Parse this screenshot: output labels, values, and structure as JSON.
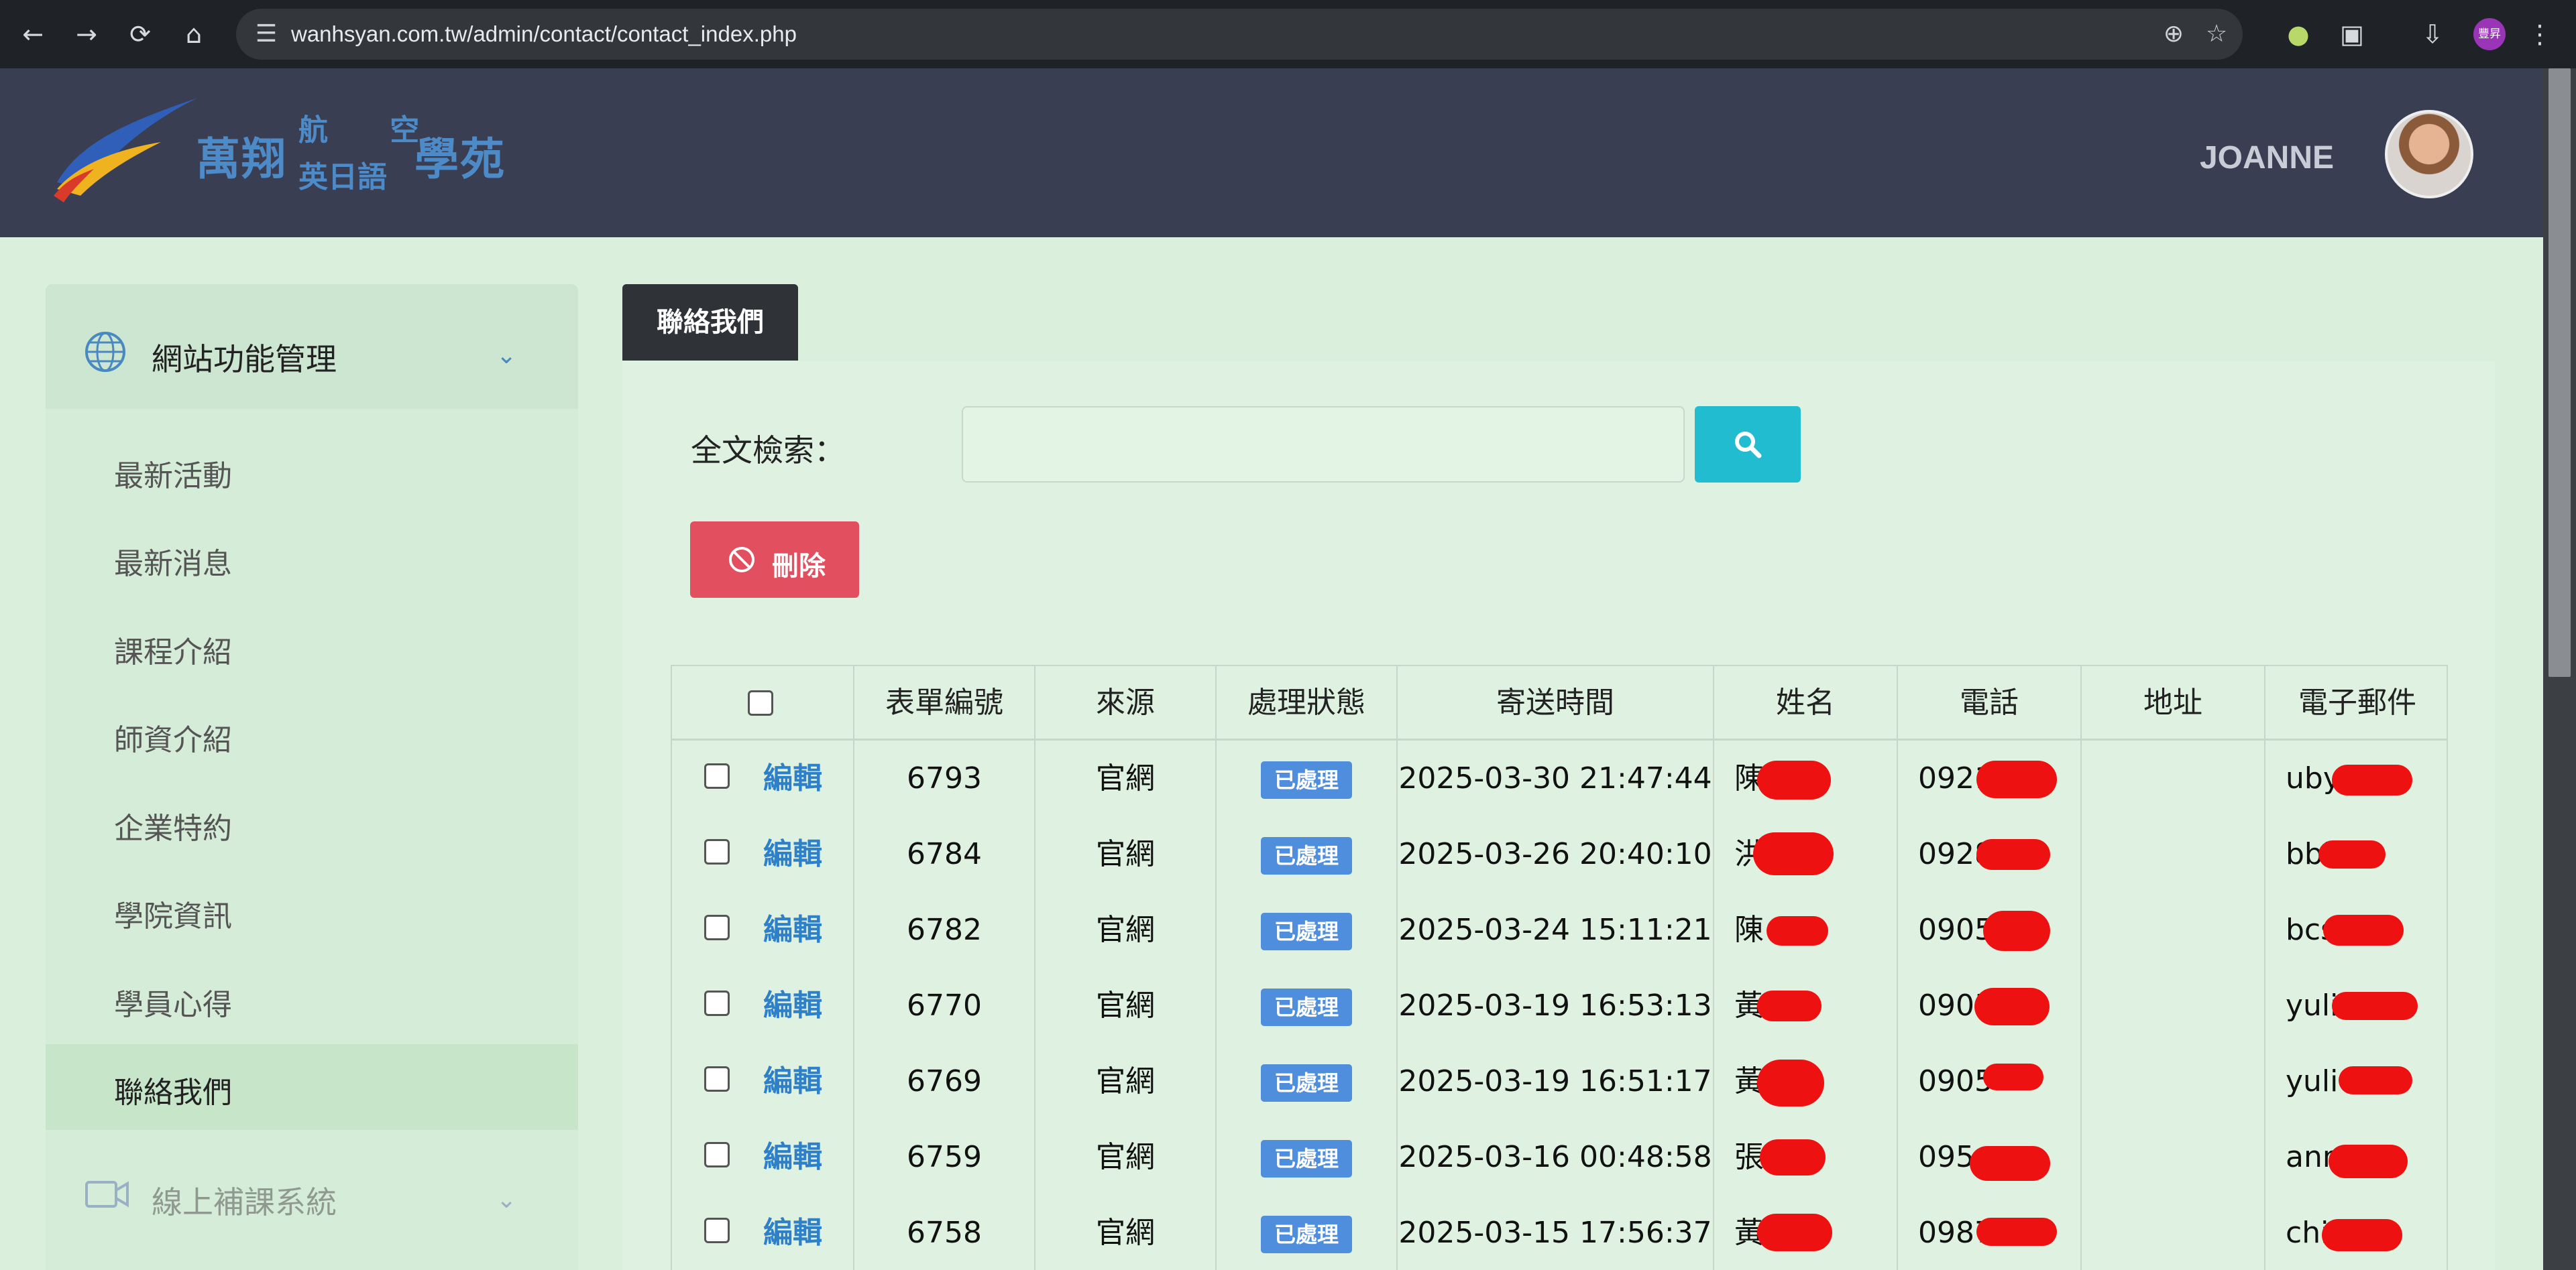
{
  "browser": {
    "url": "wanhsyan.com.tw/admin/contact/contact_index.php",
    "profile_initials": "豐昇"
  },
  "header": {
    "logo": {
      "main": "萬翔",
      "top": "航 空",
      "bottom": "英日語",
      "right": "學苑"
    },
    "user_name": "JOANNE"
  },
  "sidebar": {
    "group1_label": "網站功能管理",
    "items": [
      {
        "label": "最新活動"
      },
      {
        "label": "最新消息"
      },
      {
        "label": "課程介紹"
      },
      {
        "label": "師資介紹"
      },
      {
        "label": "企業特約"
      },
      {
        "label": "學院資訊"
      },
      {
        "label": "學員心得"
      },
      {
        "label": "聯絡我們",
        "active": true
      }
    ],
    "group2_label": "線上補課系統"
  },
  "main": {
    "tab_label": "聯絡我們",
    "search_label": "全文檢索：",
    "search_placeholder": "",
    "delete_label": "刪除"
  },
  "table": {
    "edit_label": "編輯",
    "columns": [
      "表單編號",
      "來源",
      "處理狀態",
      "寄送時間",
      "姓名",
      "電話",
      "地址",
      "電子郵件"
    ],
    "rows": [
      {
        "id": "6793",
        "source": "官網",
        "status": "已處理",
        "time": "2025-03-30 21:47:44",
        "name": "陳",
        "phone": "0921",
        "address": "",
        "email": "uby"
      },
      {
        "id": "6784",
        "source": "官網",
        "status": "已處理",
        "time": "2025-03-26 20:40:10",
        "name": "洪",
        "phone": "0928",
        "address": "",
        "email": "bbi"
      },
      {
        "id": "6782",
        "source": "官網",
        "status": "已處理",
        "time": "2025-03-24 15:11:21",
        "name": "陳",
        "phone": "0905",
        "address": "",
        "email": "bcs"
      },
      {
        "id": "6770",
        "source": "官網",
        "status": "已處理",
        "time": "2025-03-19 16:53:13",
        "name": "黃",
        "phone": "0905",
        "address": "",
        "email": "yuli"
      },
      {
        "id": "6769",
        "source": "官網",
        "status": "已處理",
        "time": "2025-03-19 16:51:17",
        "name": "黃",
        "phone": "0905",
        "address": "",
        "email": "yuli"
      },
      {
        "id": "6759",
        "source": "官網",
        "status": "已處理",
        "time": "2025-03-16 00:48:58",
        "name": "張",
        "phone": "095",
        "address": "",
        "email": "ann"
      },
      {
        "id": "6758",
        "source": "官網",
        "status": "已處理",
        "time": "2025-03-15 17:56:37",
        "name": "黃",
        "phone": "0987",
        "address": "",
        "email": "chi"
      }
    ]
  },
  "colors": {
    "page_bg": "#daf0dc",
    "header_bg": "#3a3e52",
    "search_button": "#22bcd0",
    "delete_button": "#e24f5e",
    "status_badge": "#4e8edc",
    "link": "#2e80c8"
  }
}
